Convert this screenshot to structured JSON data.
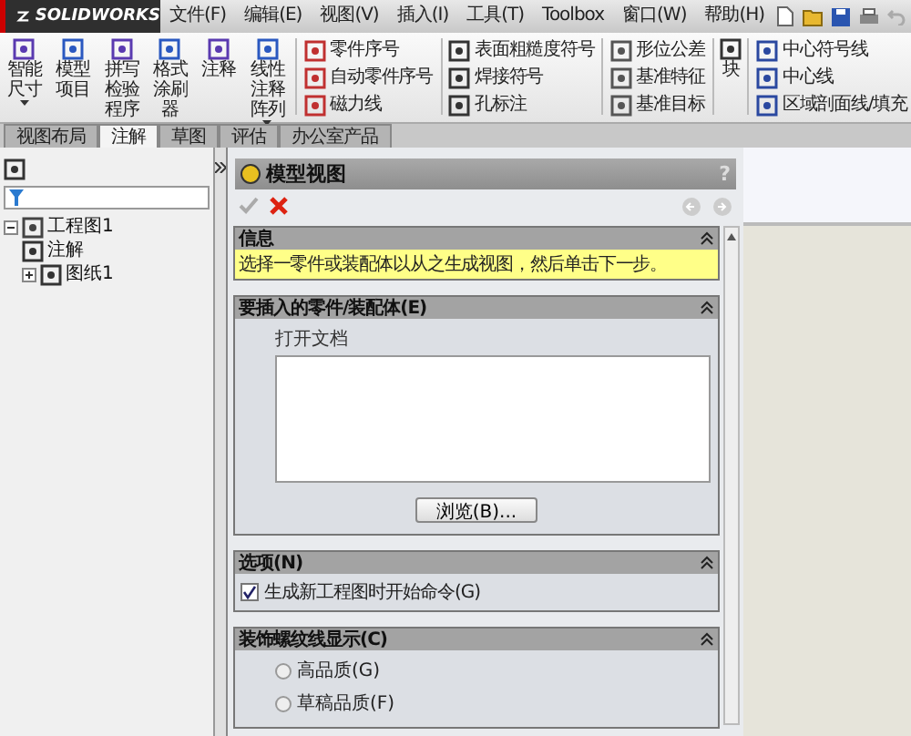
{
  "app": {
    "logo": "SOLIDWORKS"
  },
  "menu": [
    "文件(F)",
    "编辑(E)",
    "视图(V)",
    "插入(I)",
    "工具(T)",
    "Toolbox",
    "窗口(W)",
    "帮助(H)"
  ],
  "ribbon": {
    "large": [
      {
        "label": "智能尺寸",
        "dropdown": true
      },
      {
        "label": "模型项目",
        "dropdown": false
      },
      {
        "label": "拼写检验程序",
        "dropdown": false
      },
      {
        "label": "格式涂刷器",
        "dropdown": false
      },
      {
        "label": "注释",
        "dropdown": false
      },
      {
        "label": "线性注释阵列",
        "dropdown": true
      }
    ],
    "columns": [
      [
        "零件序号",
        "自动零件序号",
        "磁力线"
      ],
      [
        "表面粗糙度符号",
        "焊接符号",
        "孔标注"
      ],
      [
        "形位公差",
        "基准特征",
        "基准目标"
      ]
    ],
    "block": "块",
    "last_column": [
      "中心符号线",
      "中心线",
      "区域剖面线/填充"
    ]
  },
  "tabs": [
    {
      "label": "视图布局",
      "selected": false
    },
    {
      "label": "注解",
      "selected": true
    },
    {
      "label": "草图",
      "selected": false
    },
    {
      "label": "评估",
      "selected": false
    },
    {
      "label": "办公室产品",
      "selected": false
    }
  ],
  "tree": [
    {
      "label": "工程图1",
      "expanded": true,
      "children": [
        {
          "label": "注解"
        },
        {
          "label": "图纸1",
          "expanded": false
        }
      ]
    }
  ],
  "property_manager": {
    "title": "模型视图",
    "help": "?",
    "info": {
      "title": "信息",
      "message": "选择一零件或装配体以从之生成视图，然后单击下一步。"
    },
    "part": {
      "title": "要插入的零件/装配体(E)",
      "list_label": "打开文档",
      "browse": "浏览(B)..."
    },
    "options": {
      "title": "选项(N)",
      "items": [
        {
          "label": "生成新工程图时开始命令(G)",
          "checked": true
        }
      ]
    },
    "thread": {
      "title": "装饰螺纹线显示(C)",
      "items": [
        {
          "label": "高品质(G)",
          "selected": false
        },
        {
          "label": "草稿品质(F)",
          "selected": false
        }
      ]
    }
  }
}
